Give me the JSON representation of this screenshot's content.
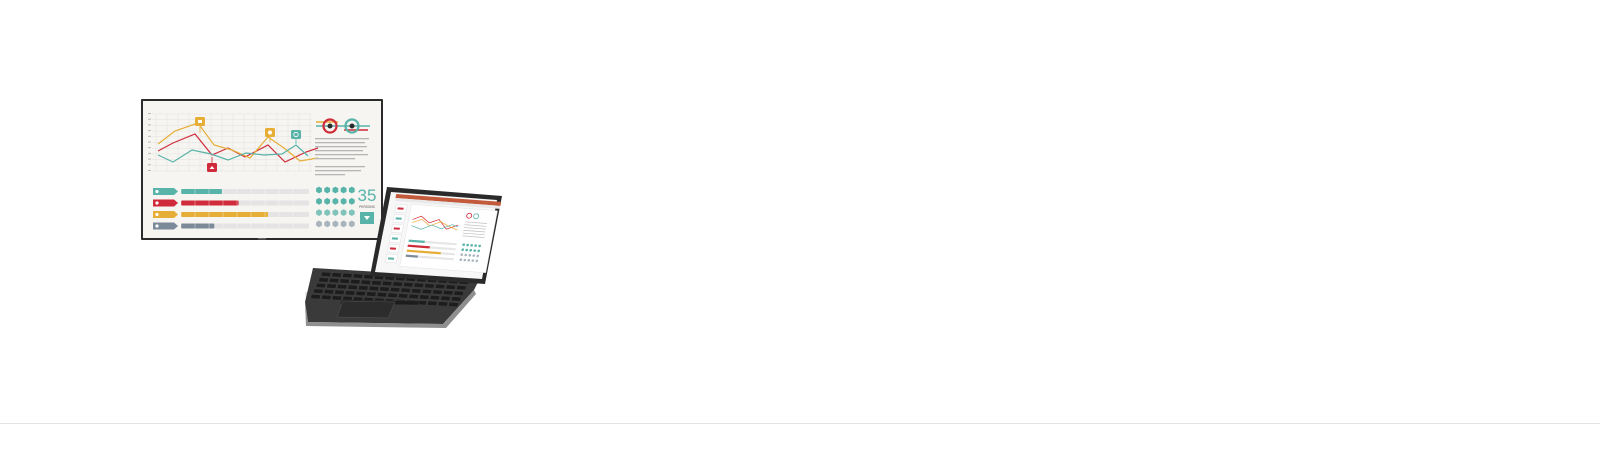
{
  "hero": {
    "illustration": "display-and-laptop-illustration",
    "monitor": {
      "stat_number": "35",
      "stat_caption": "PERSONS",
      "pin_icons": [
        "lock-icon",
        "gear-icon",
        "globe-icon",
        "house-icon"
      ],
      "bars": [
        {
          "color": "#58b3a9",
          "fill": 0.32
        },
        {
          "color": "#cf2b3a",
          "fill": 0.45
        },
        {
          "color": "#e6ae36",
          "fill": 0.68
        },
        {
          "color": "#7a8a99",
          "fill": 0.26
        }
      ]
    },
    "laptop": {
      "screen_app": "presentation-slide-editor"
    }
  },
  "colors": {
    "teal": "#58b3a9",
    "red": "#cf2b3a",
    "yellow": "#e6ae36",
    "slate": "#7a8a99",
    "bezel": "#2a2a2a",
    "divider": "#e3e3e3"
  }
}
